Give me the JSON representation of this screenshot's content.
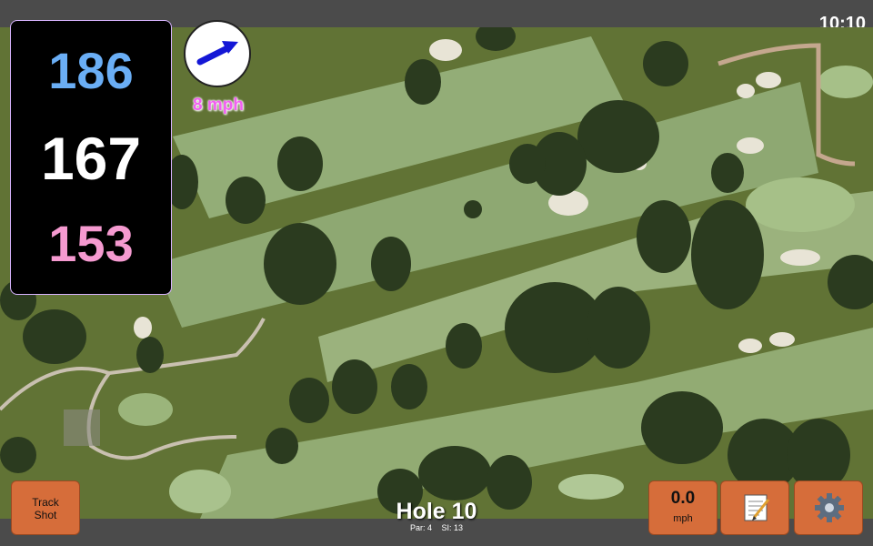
{
  "status": {
    "time": "10:10"
  },
  "yardage": {
    "back": "186",
    "middle": "167",
    "front": "153"
  },
  "wind": {
    "speed_label": "8 mph",
    "direction_icon": "arrow-icon"
  },
  "buttons": {
    "track_shot": [
      "Track",
      "Shot"
    ],
    "wind_value": "0.0",
    "wind_unit": "mph",
    "notes_icon": "notepad-icon",
    "settings_icon": "gear-icon"
  },
  "hole": {
    "title": "Hole 10",
    "par_label": "Par: 4",
    "si_label": "SI: 13"
  },
  "colors": {
    "back": "#6aaef5",
    "middle": "#ffffff",
    "front": "#f59ad0",
    "button": "#d66d3a",
    "wind_text": "#f25ff1"
  }
}
